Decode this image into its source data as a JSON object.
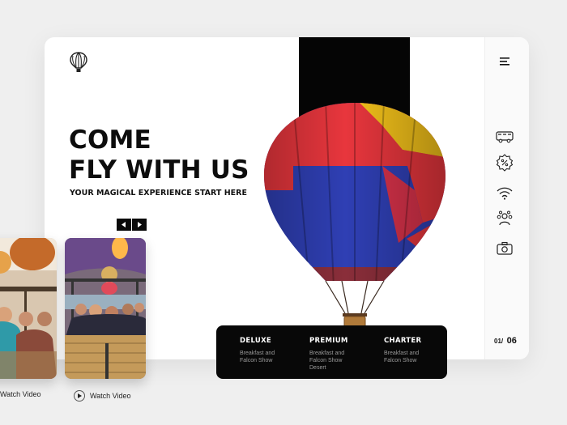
{
  "hero": {
    "headline_line1": "COME",
    "headline_line2": "FLY WITH US",
    "tagline": "YOUR MAGICAL EXPERIENCE START HERE"
  },
  "videos": [
    {
      "label": "Watch Video"
    },
    {
      "label": "Watch Video"
    }
  ],
  "packages": [
    {
      "title": "DELUXE",
      "desc_line1": "Breakfast and",
      "desc_line2": "Falcon Show",
      "desc_line3": ""
    },
    {
      "title": "PREMIUM",
      "desc_line1": "Breakfast and",
      "desc_line2": "Falcon Show",
      "desc_line3": "Desert"
    },
    {
      "title": "CHARTER",
      "desc_line1": "Breakfast and",
      "desc_line2": "Falcon Show",
      "desc_line3": ""
    }
  ],
  "pager": {
    "current": "01/",
    "total": "06"
  },
  "sidebar": {
    "icons": [
      "menu-icon",
      "bus-icon",
      "discount-badge-icon",
      "wifi-icon",
      "group-icon",
      "camera-icon"
    ]
  },
  "colors": {
    "background": "#efefef",
    "card": "#ffffff",
    "accent_black": "#050505",
    "balloon_red": "#e8363d",
    "balloon_blue": "#2f3fb4",
    "balloon_yellow": "#f4c21a"
  }
}
